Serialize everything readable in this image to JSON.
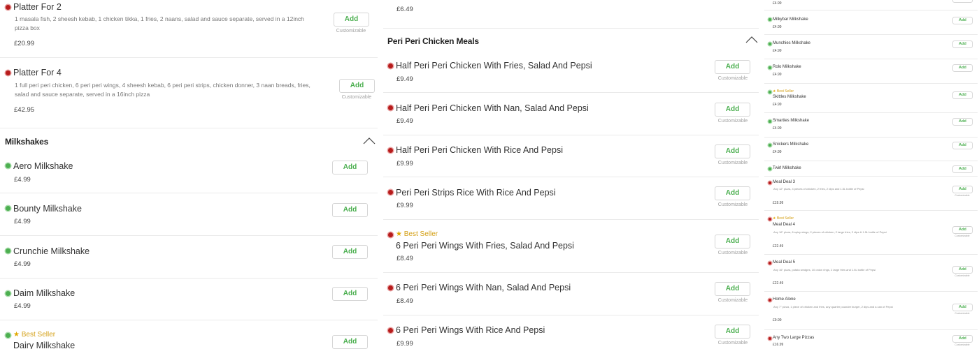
{
  "common": {
    "add_label": "Add",
    "customizable_label": "Customizable",
    "best_seller_label": "Best Seller"
  },
  "col1": {
    "platter_2": {
      "name": "Platter For 2",
      "desc": "1 masala fish, 2 sheesh kebab, 1 chicken tikka, 1 fries, 2 naans, salad and sauce separate, served in a 12inch pizza box",
      "price": "£20.99"
    },
    "platter_4": {
      "name": "Platter For 4",
      "desc": "1 full peri peri chicken, 6 peri peri wings, 4 sheesh kebab, 6 peri peri strips, chicken donner, 3 naan breads, fries, salad and sauce separate, served in a 16inch pizza",
      "price": "£42.95"
    },
    "section_title": "Milkshakes",
    "items": [
      {
        "name": "Aero Milkshake",
        "price": "£4.99"
      },
      {
        "name": "Bounty Milkshake",
        "price": "£4.99"
      },
      {
        "name": "Crunchie Milkshake",
        "price": "£4.99"
      },
      {
        "name": "Daim Milkshake",
        "price": "£4.99"
      },
      {
        "name": "Dairy Milkshake",
        "price": ""
      }
    ]
  },
  "col2": {
    "top_price": "£6.49",
    "section_title": "Peri Peri Chicken Meals",
    "items": [
      {
        "name": "Half Peri Peri Chicken With Fries, Salad And Pepsi",
        "price": "£9.49"
      },
      {
        "name": "Half Peri Peri Chicken With Nan, Salad And Pepsi",
        "price": "£9.49"
      },
      {
        "name": "Half Peri Peri Chicken With Rice And Pepsi",
        "price": "£9.99"
      },
      {
        "name": "Peri Peri Strips Rice With Rice And Pepsi",
        "price": "£9.99"
      },
      {
        "name": "6 Peri Peri Wings With Fries, Salad And Pepsi",
        "price": "£8.49"
      },
      {
        "name": "6 Peri Peri Wings With Nan, Salad And Pepsi",
        "price": "£8.49"
      },
      {
        "name": "6 Peri Peri Wings With Rice And Pepsi",
        "price": "£9.99"
      }
    ]
  },
  "col3": {
    "top_price": "£4.99",
    "items": [
      {
        "name": "Milkybar Milkshake",
        "price": "£4.99"
      },
      {
        "name": "Munchies Milkshake",
        "price": "£4.99"
      },
      {
        "name": "Rolo Milkshake",
        "price": "£4.99"
      },
      {
        "name": "Skittles Milkshake",
        "price": "£4.99"
      },
      {
        "name": "Smarties Milkshake",
        "price": "£4.99"
      },
      {
        "name": "Snickers Milkshake",
        "price": "£4.99"
      },
      {
        "name": "Twirl Milkshake",
        "price": ""
      },
      {
        "name": "Meal Deal 3",
        "desc": "Any 12\" pizza, 4 pieces of chicken, 2 fries, 2 dips and 1.5L bottle of Pepsi",
        "price": "£19.99"
      },
      {
        "name": "Meal Deal 4",
        "desc": "Any 16\" pizza, 6 spicy wings, 2 pieces of chicken, 2 large fries, 2 dips & 1.5L bottle of Pepsi",
        "price": "£22.49"
      },
      {
        "name": "Meal Deal 5",
        "desc": "Any 16\" pizza, potato wedges, 10 onion rings, 2 large fries and 1.5L bottle of Pepsi",
        "price": "£22.49"
      },
      {
        "name": "Home Alone",
        "desc": "Any 7\" pizza, 1 piece of chicken and fries, any quarter pounder burger, 2 dips and a can of Pepsi",
        "price": "£9.99"
      },
      {
        "name": "Any Two Large Pizzas",
        "price": "£16.99"
      }
    ]
  }
}
